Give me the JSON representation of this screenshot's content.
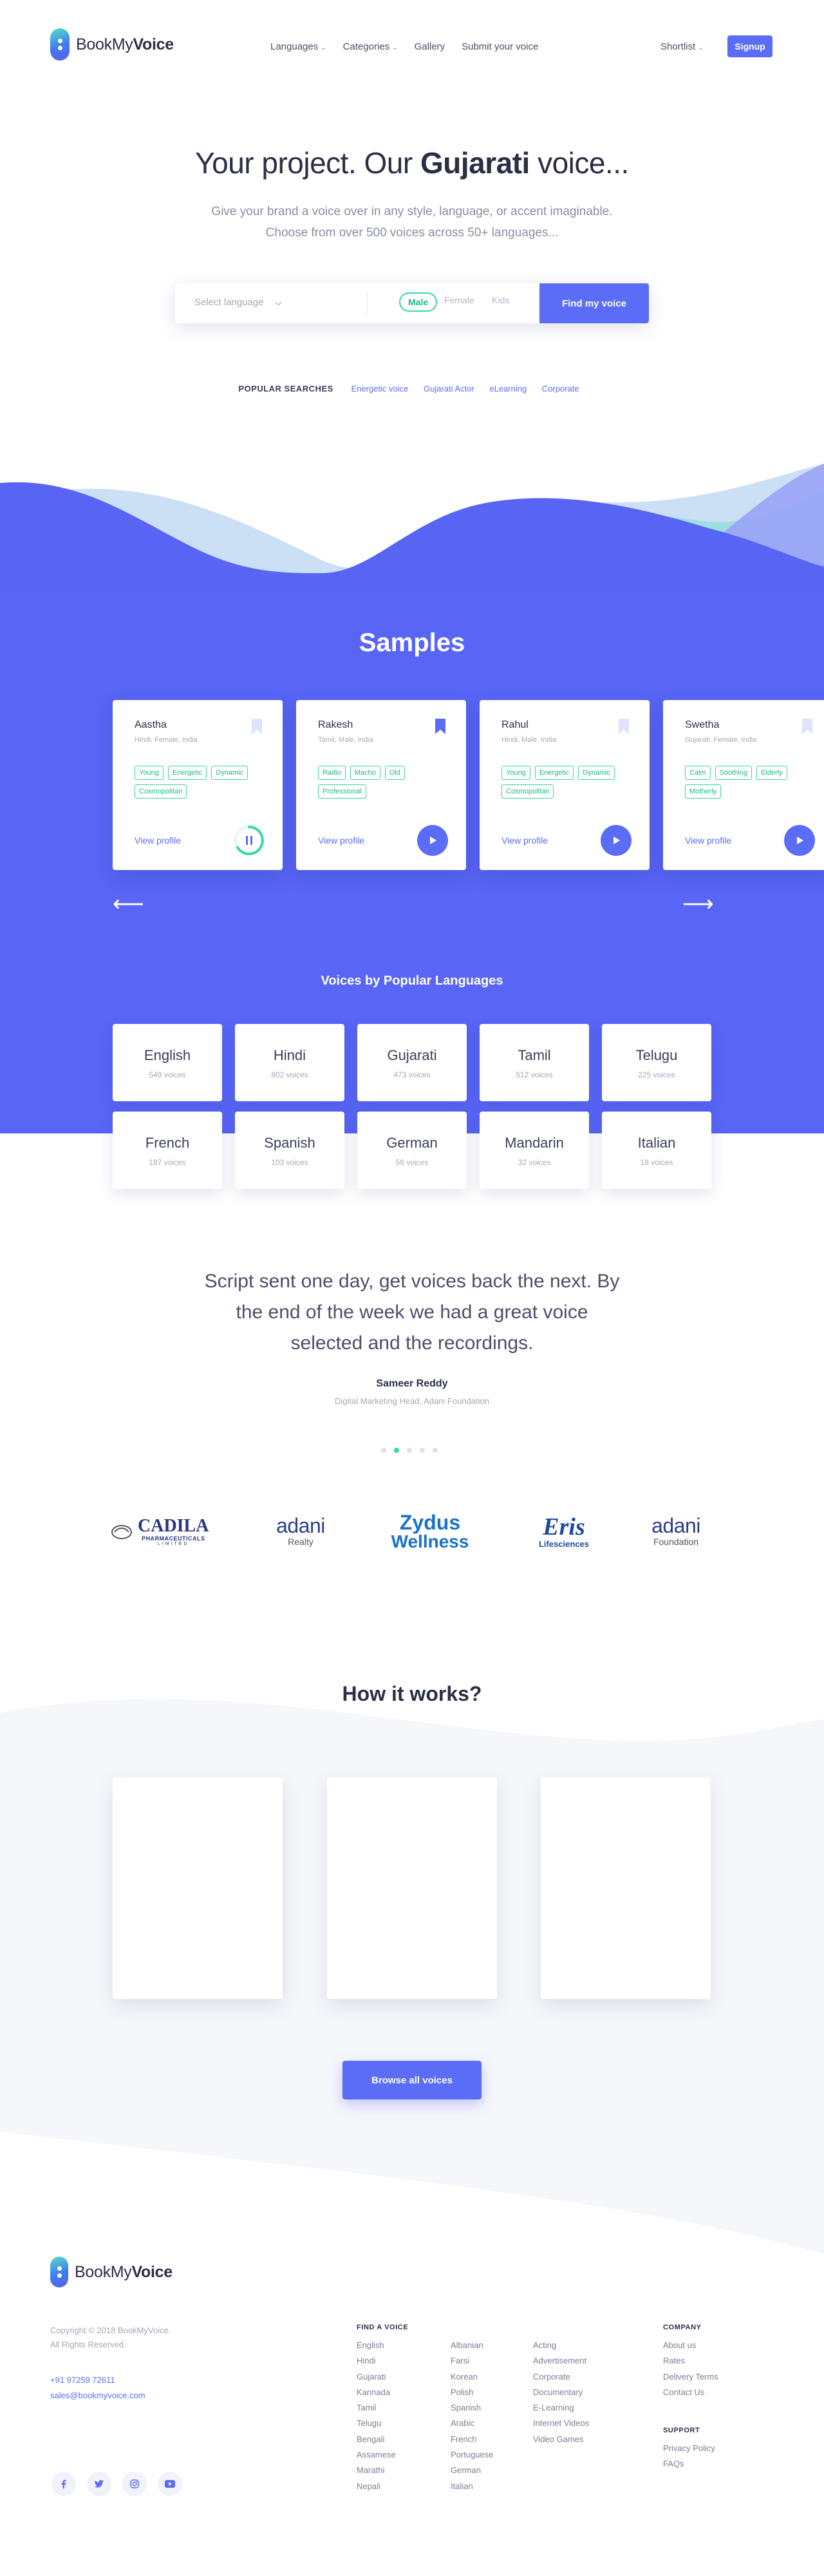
{
  "nav": {
    "brand_light": "BookMy",
    "brand_bold": "Voice",
    "links": [
      {
        "label": "Languages",
        "has_dropdown": true
      },
      {
        "label": "Categories",
        "has_dropdown": true
      },
      {
        "label": "Gallery",
        "has_dropdown": false
      },
      {
        "label": "Submit your voice",
        "has_dropdown": false
      }
    ],
    "shortlist": "Shortlist",
    "signup": "Signup"
  },
  "hero": {
    "title_pre": "Your project. Our ",
    "title_bold": "Gujarati",
    "title_post": " voice...",
    "subtitle_line1": "Give your brand a voice over in any style, language, or accent imaginable.",
    "subtitle_line2": "Choose from over 500 voices across 50+ languages...",
    "search": {
      "language_placeholder": "Select language",
      "gender_options": [
        "Male",
        "Female",
        "Kids"
      ],
      "selected_gender": "Male",
      "submit": "Find my voice"
    },
    "popular_label": "POPULAR SEARCHES",
    "popular_tags": [
      "Energetic voice",
      "Gujarati Actor",
      "eLearning",
      "Corporate"
    ]
  },
  "samples": {
    "title": "Samples",
    "cards": [
      {
        "name": "Aastha",
        "meta": "Hindi, Female, India",
        "tags": [
          "Young",
          "Energetic",
          "Dynamic",
          "Cosmopolitan"
        ],
        "link": "View profile",
        "bookmarked": false,
        "playing": true
      },
      {
        "name": "Rakesh",
        "meta": "Tamil, Male, India",
        "tags": [
          "Radio",
          "Macho",
          "Old",
          "Professional"
        ],
        "link": "View profile",
        "bookmarked": true,
        "playing": false
      },
      {
        "name": "Rahul",
        "meta": "Hindi, Male, India",
        "tags": [
          "Young",
          "Energetic",
          "Dynamic",
          "Cosmopolitan"
        ],
        "link": "View profile",
        "bookmarked": false,
        "playing": false
      },
      {
        "name": "Swetha",
        "meta": "Gujarati, Female, India",
        "tags": [
          "Calm",
          "Soothing",
          "Elderly",
          "Motherly"
        ],
        "link": "View profile",
        "bookmarked": false,
        "playing": false
      }
    ],
    "prev_arrow": "⟵",
    "next_arrow": "⟶"
  },
  "languages": {
    "title": "Voices by Popular Languages",
    "items": [
      {
        "name": "English",
        "count": "549 voices"
      },
      {
        "name": "Hindi",
        "count": "802 voices"
      },
      {
        "name": "Gujarati",
        "count": "473 voices"
      },
      {
        "name": "Tamil",
        "count": "512 voices"
      },
      {
        "name": "Telugu",
        "count": "225 voices"
      },
      {
        "name": "French",
        "count": "187 voices"
      },
      {
        "name": "Spanish",
        "count": "103 voices"
      },
      {
        "name": "German",
        "count": "56 voices"
      },
      {
        "name": "Mandarin",
        "count": "32 voices"
      },
      {
        "name": "Italian",
        "count": "18 voices"
      }
    ]
  },
  "testimonial": {
    "quote_line1": "Script sent one day, get voices back the next. By",
    "quote_line2": "the end of the week we had a great voice",
    "quote_line3": "selected and the recordings.",
    "author": "Sameer Reddy",
    "role": "Digital Marketing Head, Adani Foundation",
    "dot_count": 5,
    "active_dot": 1
  },
  "clients": [
    {
      "name": "CADILA",
      "sub": "PHARMACEUTICALS",
      "sub2": "LIMITED"
    },
    {
      "name": "adani",
      "sub": "Realty"
    },
    {
      "name": "Zydus",
      "sub": "Wellness"
    },
    {
      "name": "Eris",
      "sub": "Lifesciences"
    },
    {
      "name": "adani",
      "sub": "Foundation"
    }
  ],
  "how": {
    "title": "How it works?",
    "browse": "Browse all voices"
  },
  "footer": {
    "brand_light": "BookMy",
    "brand_bold": "Voice",
    "copyright_line1": "Copyright © 2018 BookMyVoice.",
    "copyright_line2": "All Rights Reserved.",
    "phone": "+91 97259 72611",
    "email": "sales@bookmyvoice.com",
    "find_voice_heading": "FIND A VOICE",
    "languages_col1": [
      "English",
      "Hindi",
      "Gujarati",
      "Kannada",
      "Tamil",
      "Telugu",
      "Bengali",
      "Assamese",
      "Marathi",
      "Nepali"
    ],
    "languages_col2": [
      "Albanian",
      "Farsi",
      "Korean",
      "Polish",
      "Spanish",
      "Arabic",
      "French",
      "Portuguese",
      "German",
      "Italian"
    ],
    "categories": [
      "Acting",
      "Advertisement",
      "Corporate",
      "Documentary",
      "E-Learning",
      "Internet Videos",
      "Video Games"
    ],
    "company_heading": "COMPANY",
    "company_links": [
      "About us",
      "Rates",
      "Delivery Terms",
      "Contact Us"
    ],
    "support_heading": "SUPPORT",
    "support_links": [
      "Privacy Policy",
      "FAQs"
    ],
    "social": [
      "facebook-icon",
      "twitter-icon",
      "instagram-icon",
      "youtube-icon"
    ]
  },
  "colors": {
    "primary": "#5b6cf6",
    "accent_green": "#36d8a8",
    "text_dark": "#2b2f45",
    "text_muted": "#a5a8b8"
  }
}
